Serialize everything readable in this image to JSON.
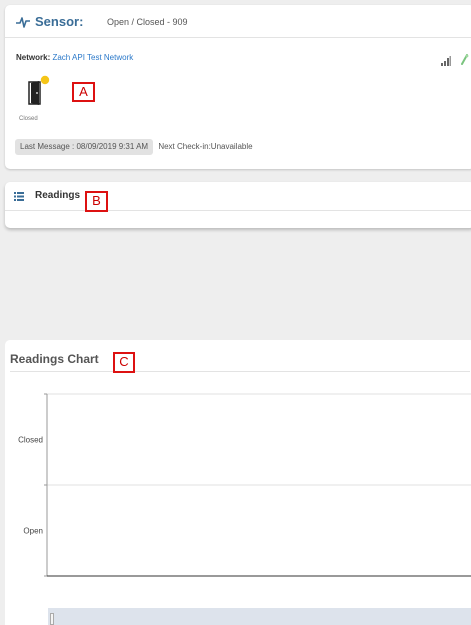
{
  "sensor": {
    "title": "Sensor:",
    "subtitle": "Open / Closed - 909",
    "network_label": "Network:",
    "network_name": "Zach API Test Network",
    "state_label": "Closed",
    "last_message": "Last Message : 08/09/2019 9:31 AM",
    "next_checkin": "Next Check-in:Unavailable",
    "icons": {
      "title": "pulse-icon",
      "door": "door-icon",
      "signal": "signal-icon",
      "battery": "battery-icon"
    },
    "status_color": "#f5c518"
  },
  "readings": {
    "title": "Readings",
    "icon": "list-icon"
  },
  "annotations": {
    "a": "A",
    "b": "B",
    "c": "C"
  },
  "chart": {
    "title": "Readings Chart"
  },
  "chart_data": {
    "type": "line",
    "title": "Readings Chart",
    "xlabel": "",
    "ylabel": "",
    "y_categories": [
      "Open",
      "Closed"
    ],
    "series": [],
    "grid": true
  },
  "colors": {
    "accent": "#3a6d97",
    "link": "#2a78c9",
    "annotation": "#dd1111"
  }
}
